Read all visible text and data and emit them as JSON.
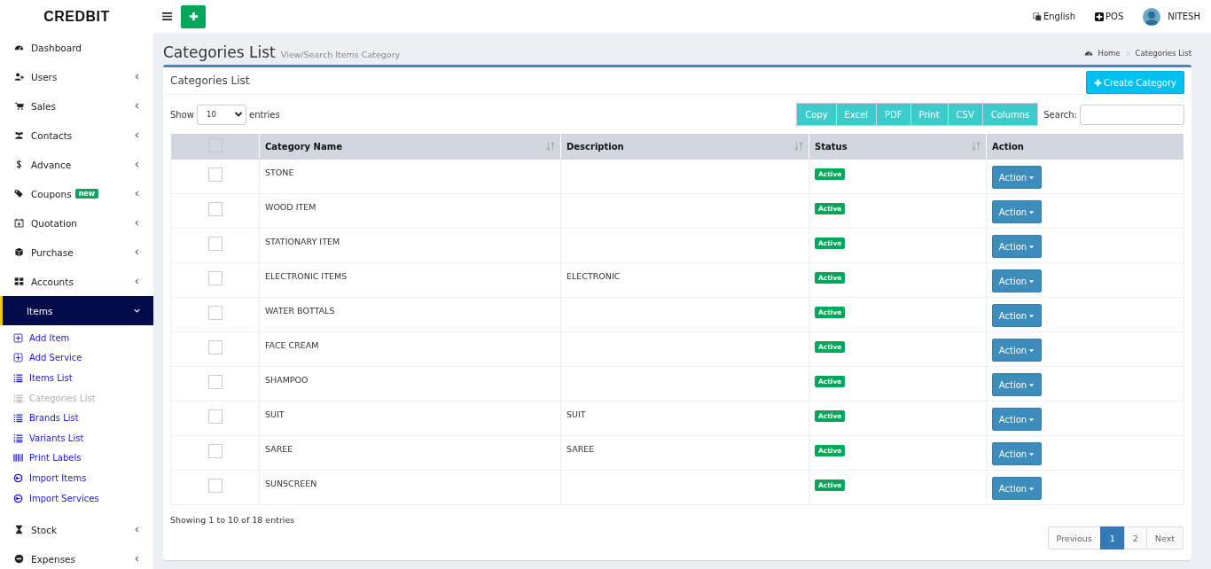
{
  "header": {
    "brand": "CREDBIT",
    "language": "English",
    "pos": "POS",
    "user": "NITESH"
  },
  "sidebar": {
    "items": [
      {
        "label": "Dashboard",
        "expandable": false,
        "expanded": false,
        "selected": false
      },
      {
        "label": "Users",
        "expandable": true,
        "expanded": false,
        "selected": false
      },
      {
        "label": "Sales",
        "expandable": true,
        "expanded": false,
        "selected": false
      },
      {
        "label": "Contacts",
        "expandable": true,
        "expanded": false,
        "selected": false
      },
      {
        "label": "Advance",
        "expandable": true,
        "expanded": false,
        "selected": false
      },
      {
        "label": "Coupons",
        "badge": "new",
        "expandable": true,
        "expanded": false,
        "selected": false
      },
      {
        "label": "Quotation",
        "expandable": true,
        "expanded": false,
        "selected": false
      },
      {
        "label": "Purchase",
        "expandable": true,
        "expanded": false,
        "selected": false
      },
      {
        "label": "Accounts",
        "expandable": true,
        "expanded": false,
        "selected": false
      },
      {
        "label": "Items",
        "expandable": true,
        "expanded": true,
        "selected": true,
        "children": [
          {
            "label": "Add Item",
            "selected": false
          },
          {
            "label": "Add Service",
            "selected": false
          },
          {
            "label": "Items List",
            "selected": false
          },
          {
            "label": "Categories List",
            "selected": true
          },
          {
            "label": "Brands List",
            "selected": false
          },
          {
            "label": "Variants List",
            "selected": false
          },
          {
            "label": "Print Labels",
            "selected": false
          },
          {
            "label": "Import Items",
            "selected": false
          },
          {
            "label": "Import Services",
            "selected": false
          }
        ]
      },
      {
        "label": "Stock",
        "expandable": true,
        "expanded": false,
        "selected": false
      },
      {
        "label": "Expenses",
        "expandable": true,
        "expanded": false,
        "selected": false
      }
    ]
  },
  "page": {
    "title": "Categories List",
    "subtitle": "View/Search Items Category",
    "breadcrumb": [
      "Home",
      "Categories List"
    ]
  },
  "box": {
    "title": "Categories List",
    "create_button": "Create Category",
    "length": {
      "before": "Show",
      "value": "10",
      "after": "entries"
    },
    "export_buttons": [
      "Copy",
      "Excel",
      "PDF",
      "Print",
      "CSV",
      "Columns"
    ],
    "search": {
      "label": "Search:"
    },
    "table": {
      "select_all_checked": false,
      "columns": [
        {
          "label": "Category Name",
          "sortable": true
        },
        {
          "label": "Description",
          "sortable": true
        },
        {
          "label": "Status",
          "sortable": true
        },
        {
          "label": "Action",
          "sortable": false
        }
      ],
      "rows": [
        {
          "checked": false,
          "name": "STONE",
          "description": "",
          "status": "Active",
          "action": "Action"
        },
        {
          "checked": false,
          "name": "WOOD ITEM",
          "description": "",
          "status": "Active",
          "action": "Action"
        },
        {
          "checked": false,
          "name": "STATIONARY ITEM",
          "description": "",
          "status": "Active",
          "action": "Action"
        },
        {
          "checked": false,
          "name": "ELECTRONIC ITEMS",
          "description": "ELECTRONIC",
          "status": "Active",
          "action": "Action"
        },
        {
          "checked": false,
          "name": "WATER BOTTALS",
          "description": "",
          "status": "Active",
          "action": "Action"
        },
        {
          "checked": false,
          "name": "FACE CREAM",
          "description": "",
          "status": "Active",
          "action": "Action"
        },
        {
          "checked": false,
          "name": "SHAMPOO",
          "description": "",
          "status": "Active",
          "action": "Action"
        },
        {
          "checked": false,
          "name": "SUIT",
          "description": "SUIT",
          "status": "Active",
          "action": "Action"
        },
        {
          "checked": false,
          "name": "SAREE",
          "description": "SAREE",
          "status": "Active",
          "action": "Action"
        },
        {
          "checked": false,
          "name": "SUNSCREEN",
          "description": "",
          "status": "Active",
          "action": "Action"
        }
      ]
    },
    "info": "Showing 1 to 10 of 18 entries",
    "pagination": [
      {
        "label": "Previous",
        "selected": false
      },
      {
        "label": "1",
        "selected": true
      },
      {
        "label": "2",
        "selected": false
      },
      {
        "label": "Next",
        "selected": false
      }
    ]
  }
}
